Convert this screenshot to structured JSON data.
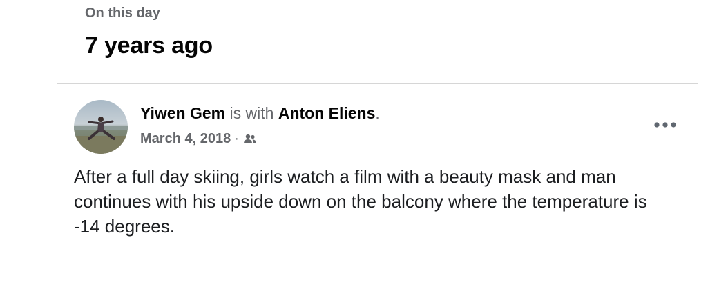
{
  "memory": {
    "kicker": "On this day",
    "title": "7 years ago"
  },
  "post": {
    "author": "Yiwen Gem",
    "with_text": " is with ",
    "tagged": "Anton Eliens",
    "period": ".",
    "date": "March 4, 2018",
    "separator": "·",
    "audience_icon": "friends-icon",
    "more_icon": "more-options-icon",
    "text": "After a full day skiing, girls watch a film with a beauty mask and man continues with his upside down on the balcony where the temperature is -14 degrees."
  },
  "colors": {
    "primary_text": "#050505",
    "secondary_text": "#65676b",
    "divider": "#d6d6d6"
  }
}
